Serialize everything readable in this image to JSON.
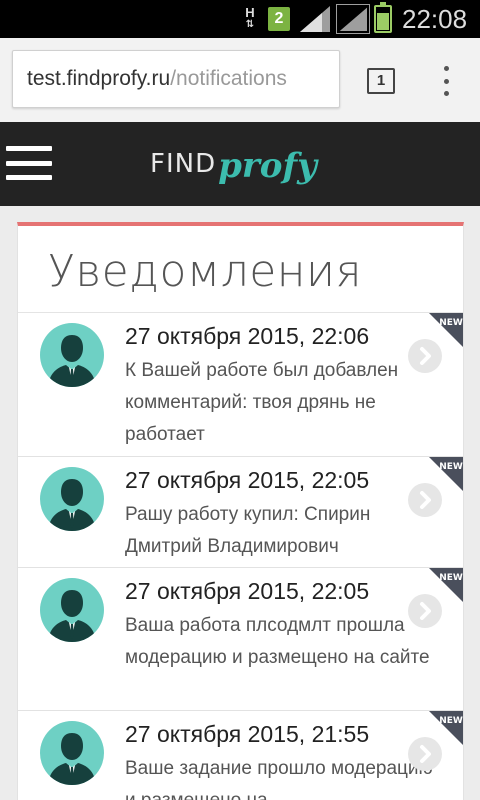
{
  "status_bar": {
    "network_type": "H",
    "notification_count": "2",
    "time": "22:08",
    "battery_level": 0.8
  },
  "browser": {
    "url_host": "test.findprofy.ru",
    "url_path": "/notifications",
    "tab_count": "1"
  },
  "site": {
    "logo_find": "FIND",
    "logo_profy": "profy"
  },
  "page": {
    "title": "Уведомления",
    "accent_color": "#e57373"
  },
  "notifications": [
    {
      "date": "27 октября 2015, 22:06",
      "text": "К Вашей работе был добавлен комментарий: твоя дрянь не работает",
      "badge": "NEW"
    },
    {
      "date": "27 октября 2015, 22:05",
      "text": "Рашу работу купил: Спирин Дмитрий Владимирович",
      "badge": "NEW"
    },
    {
      "date": "27 октября 2015, 22:05",
      "text": "Ваша работа плсодмлт прошла модерацию и размещено на сайте",
      "badge": "NEW"
    },
    {
      "date": "27 октября 2015, 21:55",
      "text": "Ваше задание прошло модерацию и размещено на",
      "badge": "NEW"
    }
  ]
}
